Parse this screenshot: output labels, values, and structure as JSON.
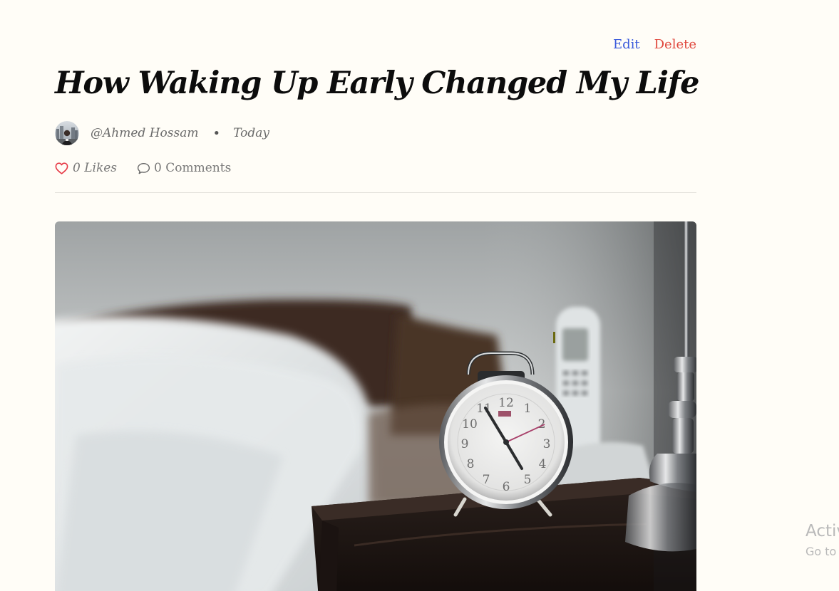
{
  "post": {
    "actions": {
      "edit_label": "Edit",
      "delete_label": "Delete",
      "edit_color": "#3b5bdb",
      "delete_color": "#e0473c"
    },
    "title": "How Waking Up Early Changed My Life",
    "author": {
      "handle": "@Ahmed Hossam",
      "date": "Today",
      "separator": "•"
    },
    "stats": {
      "likes": "0 Likes",
      "comments": "0 Comments",
      "heart_color": "#e63946"
    },
    "hero_image": {
      "subject": "alarm-clock-on-nightstand"
    }
  },
  "os_watermark": {
    "line1": "Activ",
    "line2": "Go to"
  }
}
